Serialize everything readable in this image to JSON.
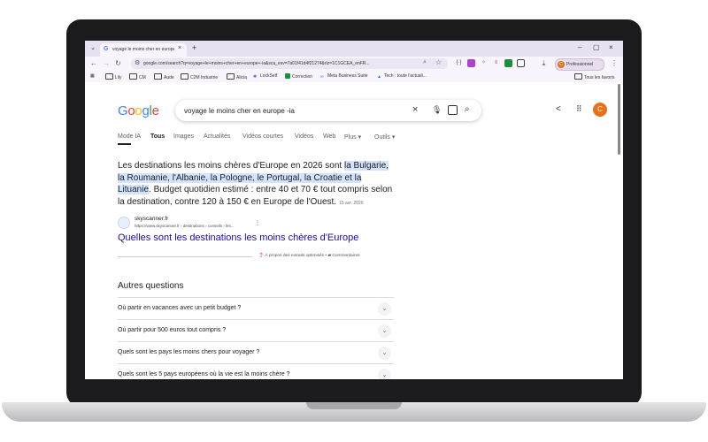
{
  "browser": {
    "tab_title": "voyage le moins cher en europe",
    "new_tab": "+",
    "url": "google.com/search?q=voyage+le+moins+cher+en+europe+-ia&sca_esv=7a01f41d4f21274&rlz=1C1GCEA_enFR...",
    "profile_initial": "C",
    "profile_label": "Professionnel",
    "bookmarks": [
      "Lily",
      "CM",
      "Aude",
      "C2M Industrie",
      "Alicia",
      "LockSelf",
      "Correction",
      "Meta Business Suite",
      "Tech : toute l'actuali..."
    ],
    "all_bookmarks": "Tous les favoris"
  },
  "google": {
    "logo": "Google",
    "query": "voyage le moins cher en europe -ia",
    "user_initial": "C",
    "tabs": [
      "Mode IA",
      "Tous",
      "Images",
      "Actualités",
      "Vidéos courtes",
      "Vidéos",
      "Web",
      "Plus",
      "Outils"
    ],
    "snippet_prefix": "Les destinations les moins chères d'Europe en 2026 sont ",
    "snippet_highlight": "la Bulgarie, la Roumanie, l'Albanie, la Pologne, le Portugal, la Croatie et la Lituanie",
    "snippet_suffix": ". Budget quotidien estimé : entre 40 et 70 € tout compris selon la destination, contre 120 à 150 € en Europe de l'Ouest.",
    "snippet_date": "15 avr. 2026",
    "source_name": "skyscanner.fr",
    "source_url": "https://www.skyscanner.fr › destinations › conseils › les...",
    "result_title": "Quelles sont les destinations les moins chères d'Europe",
    "about_snippets": "À propos des extraits optimisés",
    "feedback": "Commentaires",
    "paa_title": "Autres questions",
    "paa": [
      "Où partir en vacances avec un petit budget ?",
      "Où partir pour 500 euros tout compris ?",
      "Quels sont les pays les moins chers pour voyager ?",
      "Quels sont les 5 pays européens où la vie est la moins chère ?"
    ]
  }
}
